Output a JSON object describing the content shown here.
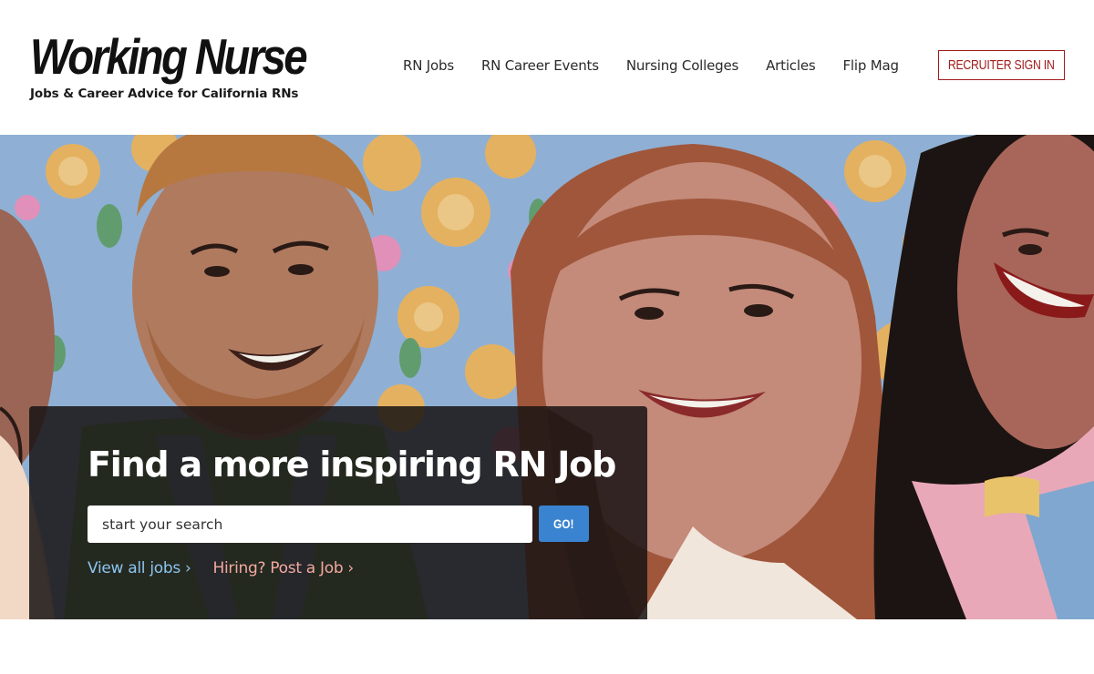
{
  "brand": {
    "title": "Working Nurse",
    "tagline": "Jobs & Career Advice for California RNs"
  },
  "nav": {
    "items": [
      {
        "label": "RN Jobs"
      },
      {
        "label": "RN Career Events"
      },
      {
        "label": "Nursing Colleges"
      },
      {
        "label": "Articles"
      },
      {
        "label": "Flip Mag"
      }
    ],
    "recruiter_label": "RECRUITER SIGN IN"
  },
  "hero": {
    "illustration": "illustrated-nurses-floral-background",
    "heading": "Find a more inspiring RN Job",
    "search": {
      "placeholder": "start your search",
      "button_label": "GO!"
    },
    "links": {
      "view_all": "View all jobs ›",
      "post_job": "Hiring? Post a Job ›"
    }
  },
  "colors": {
    "accent_red": "#a01c1c",
    "go_blue": "#3a83d0",
    "link_blue": "#8cc4ee",
    "link_pink": "#f2a9a0"
  }
}
